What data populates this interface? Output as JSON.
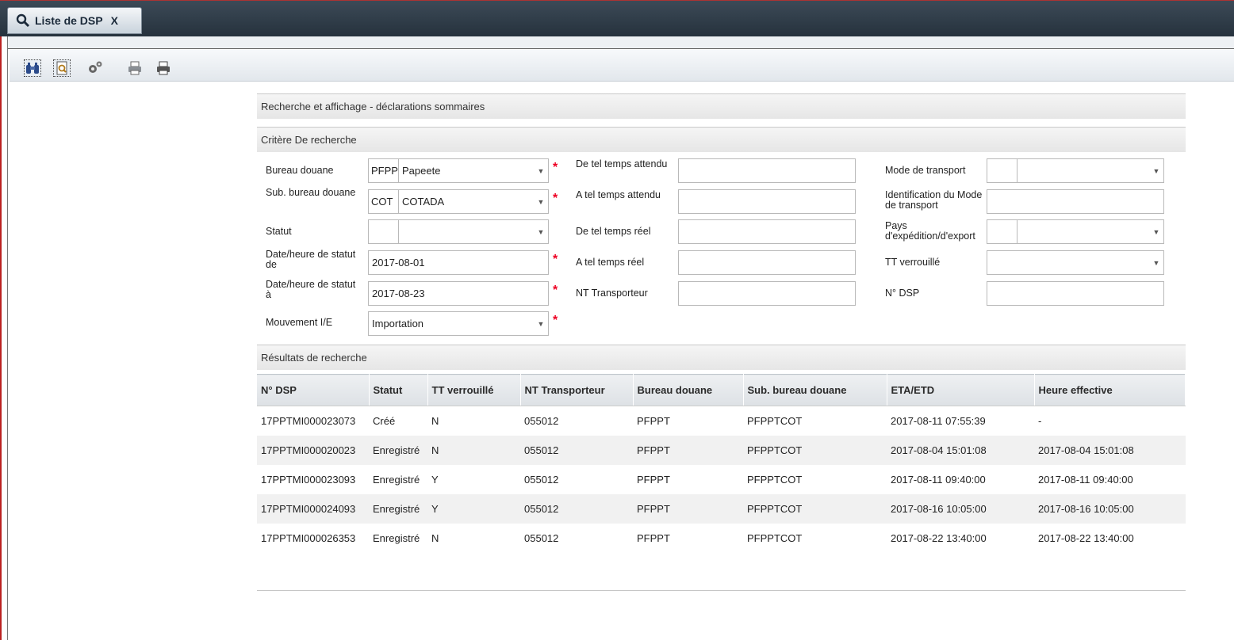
{
  "tab": {
    "title": "Liste de DSP",
    "close": "X"
  },
  "toolbar": {
    "icons": [
      "binoculars-icon",
      "document-search-icon",
      "settings-icon",
      "print-preview-icon",
      "print-icon"
    ]
  },
  "page_title": "Recherche et affichage - déclarations sommaires",
  "criteria": {
    "section_title": "Critère De recherche",
    "bureau_douane": {
      "label": "Bureau douane",
      "code": "PFPPT",
      "value": "Papeete"
    },
    "sub_bureau": {
      "label": "Sub. bureau douane",
      "code": "COT",
      "value": "COTADA"
    },
    "statut": {
      "label": "Statut",
      "code": "",
      "value": ""
    },
    "date_de": {
      "label": "Date/heure de statut de",
      "value": "2017-08-01"
    },
    "date_a": {
      "label": "Date/heure de statut à",
      "value": "2017-08-23"
    },
    "mouvement": {
      "label": "Mouvement I/E",
      "value": "Importation"
    },
    "de_tel_attendu": {
      "label": "De tel temps attendu",
      "value": ""
    },
    "a_tel_attendu": {
      "label": "A tel temps attendu",
      "value": ""
    },
    "de_tel_reel": {
      "label": "De tel temps réel",
      "value": ""
    },
    "a_tel_reel": {
      "label": "A tel temps réel",
      "value": ""
    },
    "nt_transporteur": {
      "label": "NT Transporteur",
      "value": ""
    },
    "mode_transport": {
      "label": "Mode de transport",
      "code": "",
      "value": ""
    },
    "ident_mode": {
      "label": "Identification du Mode de transport",
      "value": ""
    },
    "pays": {
      "label": "Pays d'expédition/d'export",
      "code": "",
      "value": ""
    },
    "tt_verrouille": {
      "label": "TT verrouillé",
      "value": ""
    },
    "no_dsp": {
      "label": "N° DSP",
      "value": ""
    }
  },
  "results": {
    "section_title": "Résultats de recherche",
    "columns": [
      "N° DSP",
      "Statut",
      "TT verrouillé",
      "NT Transporteur",
      "Bureau douane",
      "Sub. bureau douane",
      "ETA/ETD",
      "Heure effective"
    ],
    "rows": [
      [
        "17PPTMI000023073",
        "Créé",
        "N",
        "055012",
        "PFPPT",
        "PFPPTCOT",
        "2017-08-11 07:55:39",
        "-"
      ],
      [
        "17PPTMI000020023",
        "Enregistré",
        "N",
        "055012",
        "PFPPT",
        "PFPPTCOT",
        "2017-08-04 15:01:08",
        "2017-08-04 15:01:08"
      ],
      [
        "17PPTMI000023093",
        "Enregistré",
        "Y",
        "055012",
        "PFPPT",
        "PFPPTCOT",
        "2017-08-11 09:40:00",
        "2017-08-11 09:40:00"
      ],
      [
        "17PPTMI000024093",
        "Enregistré",
        "Y",
        "055012",
        "PFPPT",
        "PFPPTCOT",
        "2017-08-16 10:05:00",
        "2017-08-16 10:05:00"
      ],
      [
        "17PPTMI000026353",
        "Enregistré",
        "N",
        "055012",
        "PFPPT",
        "PFPPTCOT",
        "2017-08-22 13:40:00",
        "2017-08-22 13:40:00"
      ]
    ]
  }
}
